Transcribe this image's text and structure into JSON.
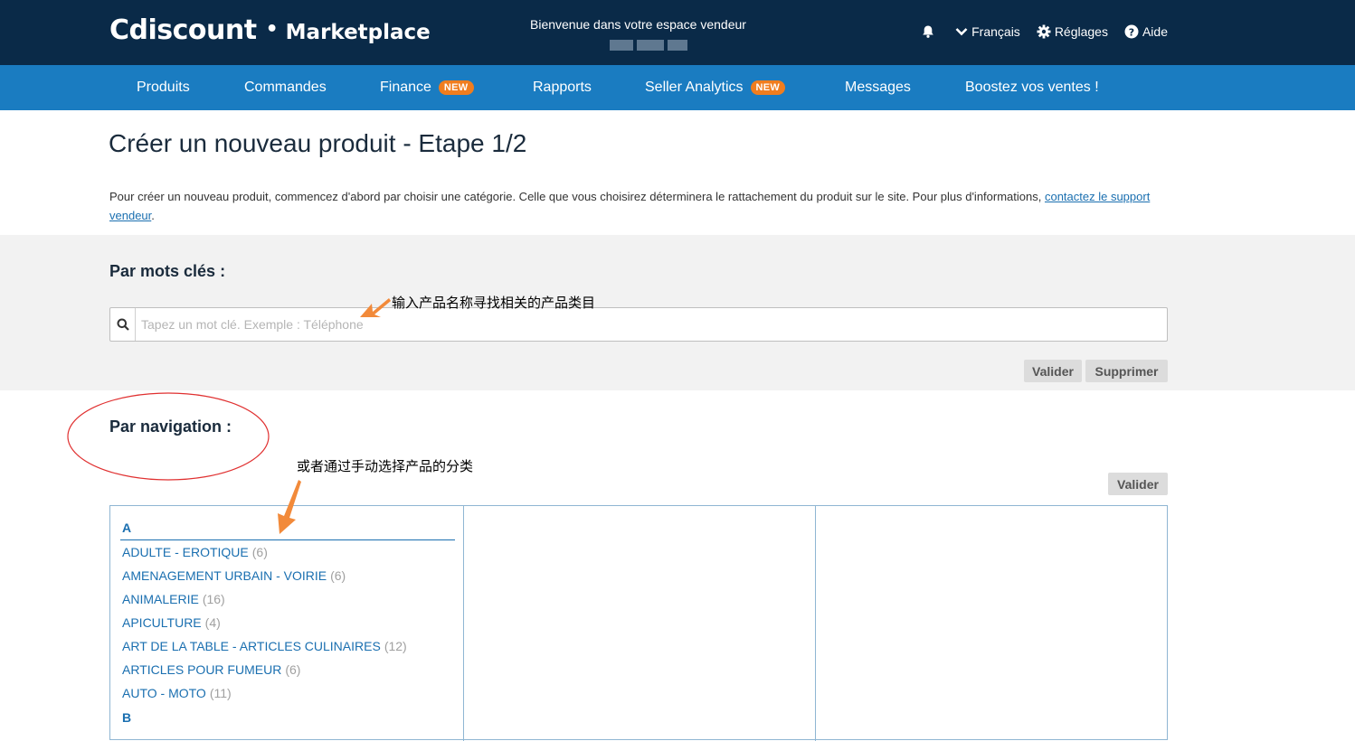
{
  "header": {
    "logo_brand": "Cdiscount",
    "logo_dot": "•",
    "logo_sub": "Marketplace",
    "welcome": "Bienvenue dans votre espace vendeur",
    "links": {
      "language": "Français",
      "settings": "Réglages",
      "help": "Aide"
    }
  },
  "nav": {
    "items": [
      {
        "label": "Produits",
        "badge": ""
      },
      {
        "label": "Commandes",
        "badge": ""
      },
      {
        "label": "Finance",
        "badge": "NEW"
      },
      {
        "label": "Rapports",
        "badge": ""
      },
      {
        "label": "Seller Analytics",
        "badge": "NEW"
      },
      {
        "label": "Messages",
        "badge": ""
      },
      {
        "label": "Boostez vos ventes !",
        "badge": ""
      }
    ]
  },
  "page": {
    "title": "Créer un nouveau produit - Etape 1/2",
    "intro_text": "Pour créer un nouveau produit, commencez d'abord par choisir une catégorie. Celle que vous choisirez déterminera le rattachement du produit sur le site. Pour plus d'informations, ",
    "intro_link": "contactez le support vendeur",
    "intro_end": "."
  },
  "keywords": {
    "heading": "Par mots clés :",
    "placeholder": "Tapez un mot clé. Exemple : Téléphone",
    "value": "",
    "validate_label": "Valider",
    "delete_label": "Supprimer"
  },
  "navigation": {
    "heading": "Par navigation :",
    "validate_label": "Valider",
    "letters": [
      "A",
      "B"
    ],
    "categories": [
      {
        "name": "ADULTE - EROTIQUE",
        "count": "(6)"
      },
      {
        "name": "AMENAGEMENT URBAIN - VOIRIE",
        "count": "(6)"
      },
      {
        "name": "ANIMALERIE",
        "count": "(16)"
      },
      {
        "name": "APICULTURE",
        "count": "(4)"
      },
      {
        "name": "ART DE LA TABLE - ARTICLES CULINAIRES",
        "count": "(12)"
      },
      {
        "name": "ARTICLES POUR FUMEUR",
        "count": "(6)"
      },
      {
        "name": "AUTO - MOTO",
        "count": "(11)"
      }
    ]
  },
  "annotations": {
    "search_note": "输入产品名称寻找相关的产品类目",
    "nav_note": "或者通过手动选择产品的分类"
  },
  "colors": {
    "header_bg": "#0a2a48",
    "nav_bg": "#1a7cc1",
    "badge": "#f07d1e",
    "link": "#1a6fb0",
    "annotation_arrow": "#f28a3a",
    "annotation_circle": "#e03030"
  }
}
